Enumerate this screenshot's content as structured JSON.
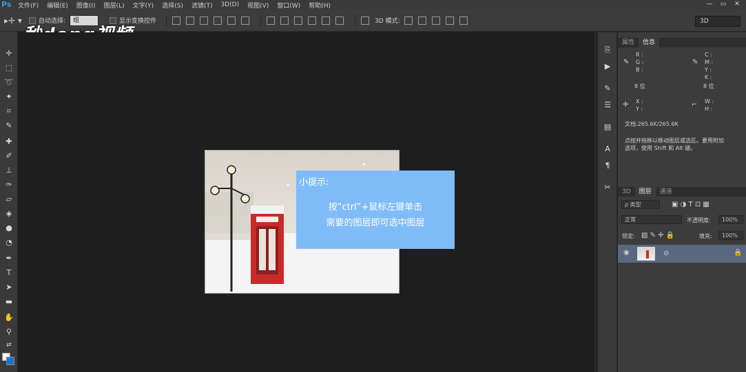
{
  "app": {
    "logo": "Ps"
  },
  "menu": [
    "文件(F)",
    "编辑(E)",
    "图像(I)",
    "图层(L)",
    "文字(Y)",
    "选择(S)",
    "滤镜(T)",
    "3D(D)",
    "视图(V)",
    "窗口(W)",
    "帮助(H)"
  ],
  "window_controls": [
    "—",
    "▭",
    "✕"
  ],
  "options": {
    "auto_select_label": "自动选择:",
    "auto_select_value": "组",
    "show_transform_label": "显示变换控件",
    "mode_3d_label": "3D 模式:",
    "workspace_value": "3D"
  },
  "watermark": {
    "text": "秒dong视频"
  },
  "hint": {
    "title": "小提示:",
    "line1": "按“ctrl”+鼠标左键单击",
    "line2": "需要的图层即可选中图层"
  },
  "info_panel": {
    "tabs": [
      "属性",
      "信息"
    ],
    "rgb": "R :\nG :\nB :",
    "cmyk": "C :\nM :\nY :\nK :",
    "bits_left": "8 位",
    "bits_right": "8 位",
    "xy": "X :\nY :",
    "wh": "W :\nH :",
    "doc": "文档:265.6K/265.6K",
    "tip": "点按并拖移以移动图层或选区。要用附加\n选项，使用 Shift 和 Alt 键。"
  },
  "layers_panel": {
    "tabs": [
      "3D",
      "图层",
      "通道"
    ],
    "filter_label": "ρ 类型",
    "blend_mode": "正常",
    "opacity_label": "不透明度:",
    "opacity_value": "100%",
    "lock_label": "锁定:",
    "fill_label": "填充:",
    "fill_value": "100%"
  },
  "colors": {
    "hint_bg": "#7fbbf7",
    "canvas_bg": "#1e1e1e",
    "selected_layer": "#596781",
    "foreground": "#ffffff",
    "background": "#1e6fd8"
  }
}
